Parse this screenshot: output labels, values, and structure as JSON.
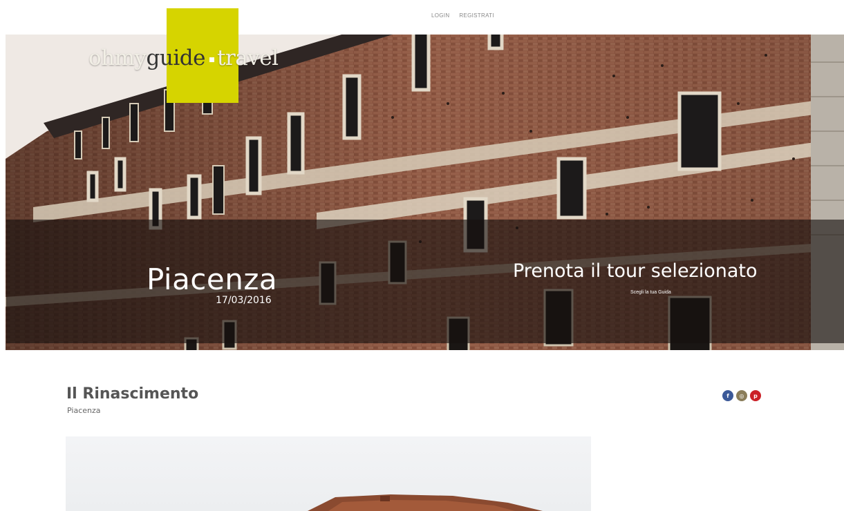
{
  "nav": {
    "login": "LOGIN",
    "register": "REGISTRATI"
  },
  "logo": {
    "part1": "ohmy",
    "part2": "guide",
    "part3": "travel"
  },
  "hero": {
    "city": "Piacenza",
    "date": "17/03/2016",
    "cta_title": "Prenota il tour selezionato",
    "cta_subtitle": "Scegli la tua Guida"
  },
  "tour": {
    "title": "Il Rinascimento",
    "city": "Piacenza"
  },
  "social": [
    {
      "icon": "facebook-icon",
      "glyph": "f",
      "color": "#3b5998"
    },
    {
      "icon": "share-icon",
      "glyph": "◎",
      "color": "#8a7d5a"
    },
    {
      "icon": "pinterest-icon",
      "glyph": "p",
      "color": "#cb2027"
    }
  ],
  "colors": {
    "brand_yellow": "#d6d400",
    "overlay": "rgba(22,16,14,0.62)"
  }
}
